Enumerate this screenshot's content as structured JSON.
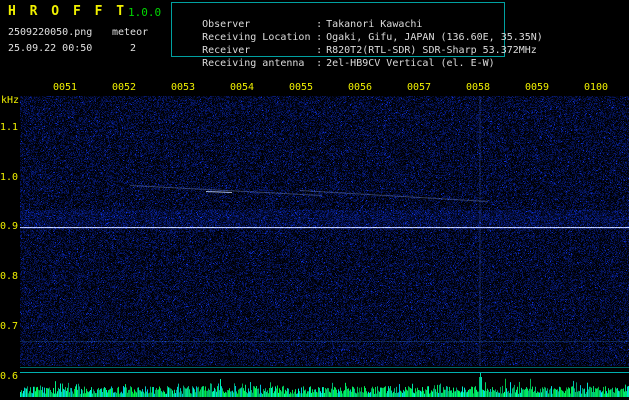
{
  "app": {
    "title": "H R O F F T",
    "version": "1.0.0",
    "filename": "2509220050.png",
    "mode": "meteor",
    "datetime": "25.09.22 00:50",
    "count": "2"
  },
  "info": {
    "separator": ":",
    "rows": [
      {
        "label": "Observer",
        "value": "Takanori Kawachi"
      },
      {
        "label": "Receiving Location",
        "value": "Ogaki, Gifu, JAPAN (136.60E, 35.35N)"
      },
      {
        "label": "Receiver",
        "value": "R820T2(RTL-SDR) SDR-Sharp 53.372MHz"
      },
      {
        "label": "Receiving antenna",
        "value": "2el-HB9CV Vertical (el. E-W)"
      }
    ]
  },
  "chart_data": {
    "type": "heatmap",
    "title": "HROFFT radio meteor observation spectrogram",
    "x_axis": {
      "ticks": [
        "0051",
        "0052",
        "0053",
        "0054",
        "0055",
        "0056",
        "0057",
        "0058",
        "0059",
        "0100"
      ]
    },
    "y_axis": {
      "unit_label": "kHz",
      "ticks": [
        "1.1",
        "1.0",
        "0.9",
        "0.8",
        "0.7",
        "0.6"
      ],
      "range": [
        0.6,
        1.17
      ]
    },
    "features": {
      "carrier_line_khz": 0.9,
      "noise_band_khz": [
        0.9,
        0.95
      ],
      "diagonal_echo_traces": "faint descending doppler traces near 0.93-1.0 kHz between 0052 and 0057",
      "vertical_event_marker": "faint vertical echo column near 0057",
      "faint_interference_line_khz": 0.67
    },
    "level_strip": {
      "description": "signal-level trace along bottom with noisy baseline and a spike near 0057"
    },
    "colors": {
      "background": "#000000",
      "noise_blue": "#0000a0",
      "carrier_line": "#d2e0ff",
      "axis_text": "#f0f000",
      "level_trace": "#00c864",
      "frame_cyan": "#00b0b0"
    }
  }
}
